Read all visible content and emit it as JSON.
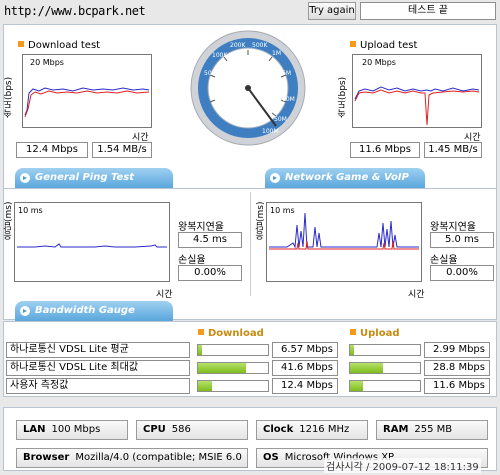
{
  "header": {
    "url": "http://www.bcpark.net",
    "try_again_label": "Try again",
    "status_label": "테스트 끝"
  },
  "download": {
    "title": "Download test",
    "y_label": "속도(bps)",
    "axis_max": "20 Mbps",
    "x_label": "시간",
    "mbps": "12.4 Mbps",
    "mbs": "1.54 MB/s"
  },
  "upload": {
    "title": "Upload test",
    "y_label": "속도(bps)",
    "axis_max": "20 Mbps",
    "x_label": "시간",
    "mbps": "11.6 Mbps",
    "mbs": "1.45 MB/s"
  },
  "gauge": {
    "ticks": [
      "50K",
      "100K",
      "200K",
      "500K",
      "1M",
      "5M",
      "10M",
      "50M",
      "100M"
    ]
  },
  "tabs": {
    "ping": "General Ping Test",
    "game": "Network Game & VoIP Test",
    "bandwidth": "Bandwidth Gauge"
  },
  "ping": {
    "y_label": "응답(ms)",
    "axis_max": "10 ms",
    "x_label": "시간",
    "rtt_label": "왕복지연율",
    "rtt": "4.5 ms",
    "loss_label": "손실율",
    "loss": "0.00%"
  },
  "game": {
    "y_label": "응답(ms)",
    "axis_max": "10 ms",
    "x_label": "시간",
    "rtt_label": "왕복지연율",
    "rtt": "5.0 ms",
    "loss_label": "손실율",
    "loss": "0.00%"
  },
  "bandwidth": {
    "download_header": "Download",
    "upload_header": "Upload",
    "rows": [
      {
        "label": "하나로통신 VDSL Lite 평균",
        "download": "6.57 Mbps",
        "download_fraction": 0.06,
        "upload": "2.99 Mbps",
        "upload_fraction": 0.05
      },
      {
        "label": "하나로통신 VDSL Lite 최대값",
        "download": "41.6 Mbps",
        "download_fraction": 0.68,
        "upload": "28.8 Mbps",
        "upload_fraction": 0.47
      },
      {
        "label": "사용자 측정값",
        "download": "12.4 Mbps",
        "download_fraction": 0.2,
        "upload": "11.6 Mbps",
        "upload_fraction": 0.19
      }
    ]
  },
  "system": {
    "lan_label": "LAN",
    "lan": "100 Mbps",
    "cpu_label": "CPU",
    "cpu": "586",
    "clock_label": "Clock",
    "clock": "1216 MHz",
    "ram_label": "RAM",
    "ram": "255 MB",
    "browser_label": "Browser",
    "browser": "Mozilla/4.0 (compatible; MSIE 6.0",
    "os_label": "OS",
    "os": "Microsoft Windows XP"
  },
  "timestamp": "검사시각 / 2009-07-12 18:11:39",
  "colors": {
    "accent": "#f39a1c",
    "tab_blue": "#5aa7dd",
    "bar_green": "#7dbb1c",
    "series_red": "#e02020",
    "series_blue": "#2a2ac8"
  }
}
